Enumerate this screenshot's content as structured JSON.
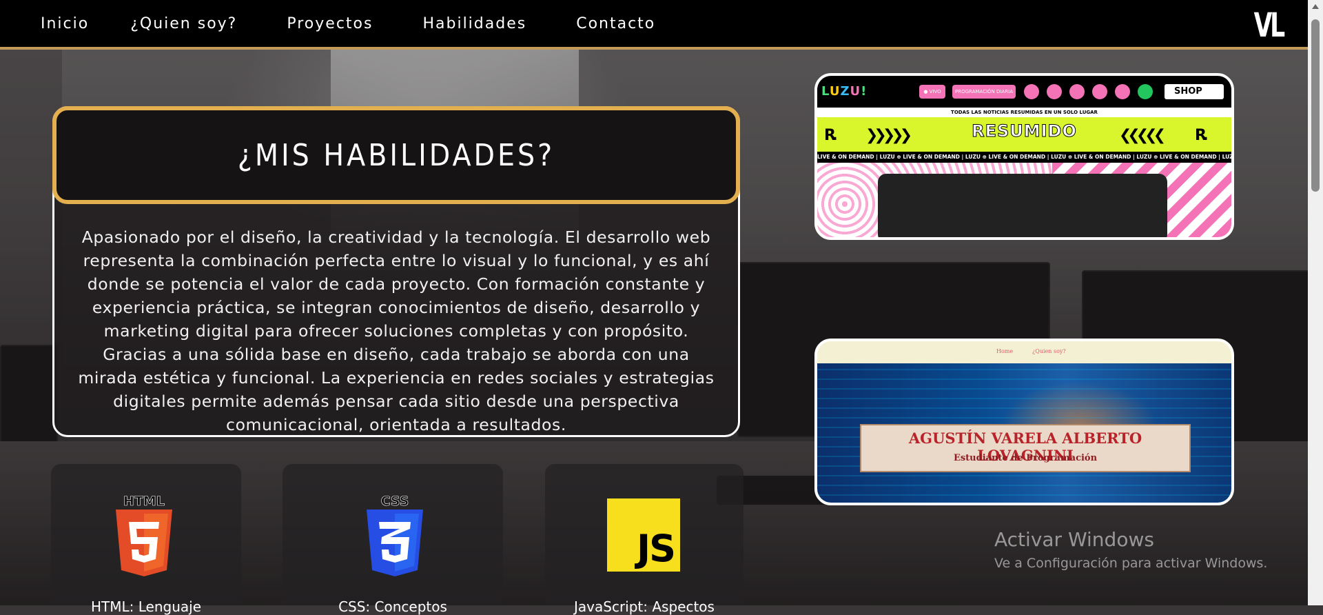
{
  "nav": {
    "items": [
      {
        "label": "Inicio"
      },
      {
        "label": "¿Quien soy?"
      },
      {
        "label": "Proyectos"
      },
      {
        "label": "Habilidades"
      },
      {
        "label": "Contacto"
      }
    ],
    "logo": "VL"
  },
  "skills": {
    "title": "¿MIS HABILIDADES?",
    "description": "Apasionado por el diseño, la creatividad y la tecnología. El desarrollo web representa la combinación perfecta entre lo visual y lo funcional, y es ahí donde se potencia el valor de cada proyecto. Con formación constante y experiencia práctica, se integran conocimientos de diseño, desarrollo y marketing digital para ofrecer soluciones completas y con propósito. Gracias a una sólida base en diseño, cada trabajo se aborda con una mirada estética y funcional. La experiencia en redes sociales y estrategias digitales permite además pensar cada sitio desde una perspectiva comunicacional, orientada a resultados."
  },
  "tech": [
    {
      "label": "HTML: Lenguaje",
      "badge": "HTML",
      "icon": "html5-icon"
    },
    {
      "label": "CSS: Conceptos",
      "badge": "CSS",
      "icon": "css3-icon"
    },
    {
      "label": "JavaScript: Aspectos",
      "badge": "JS",
      "icon": "javascript-icon"
    }
  ],
  "projects": {
    "luzu": {
      "logo": "LUZU!",
      "pill_live": "● VIVO",
      "pill_schedule": "PROGRAMACIÓN DIARIA",
      "shop": "SHOP",
      "subtitle": "TODAS LAS NOTICIAS RESUMIDAS EN UN SOLO LUGAR",
      "banner": "RESUMIDO",
      "banner_mark": "R.",
      "ticker": "LIVE & ON DEMAND  |  LUZU  ⊕  LIVE & ON DEMAND  |  LUZU  ⊕  LIVE & ON DEMAND  |  LUZU  ⊕  LIVE & ON DEMAND  |  LUZU  ⊕  LIVE & ON DEMAND  |  LUZU  ⊕  LIVE & ON DEMAND  |  LUZU"
    },
    "portfolio": {
      "nav_home": "Home",
      "nav_about": "¿Quien soy?",
      "name": "AGUSTÍN VARELA ALBERTO LOVAGNINI",
      "role": "Estudiante de Programación"
    }
  },
  "watermark": {
    "title": "Activar Windows",
    "subtitle": "Ve a Configuración para activar Windows."
  },
  "colors": {
    "accent_gold": "#e4b04f",
    "nav_bg": "#000000"
  }
}
